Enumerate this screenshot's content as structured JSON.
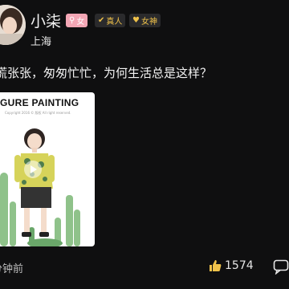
{
  "user": {
    "name": "小柒",
    "location": "上海",
    "badges": {
      "gender": "女",
      "real": "真人",
      "god": "女神"
    }
  },
  "post": {
    "text": "慌张张，匆匆忙忙，为何生活总是这样？",
    "image": {
      "title": "GURE PAINTING",
      "copyright": "Copyright 2016 © 版权 All right reserved."
    },
    "time": "分钟前",
    "likes": "1574"
  },
  "colors": {
    "background": "#0f0f10",
    "gender_badge": "#f3a6b5",
    "gold_badge_text": "#f0c24a"
  }
}
